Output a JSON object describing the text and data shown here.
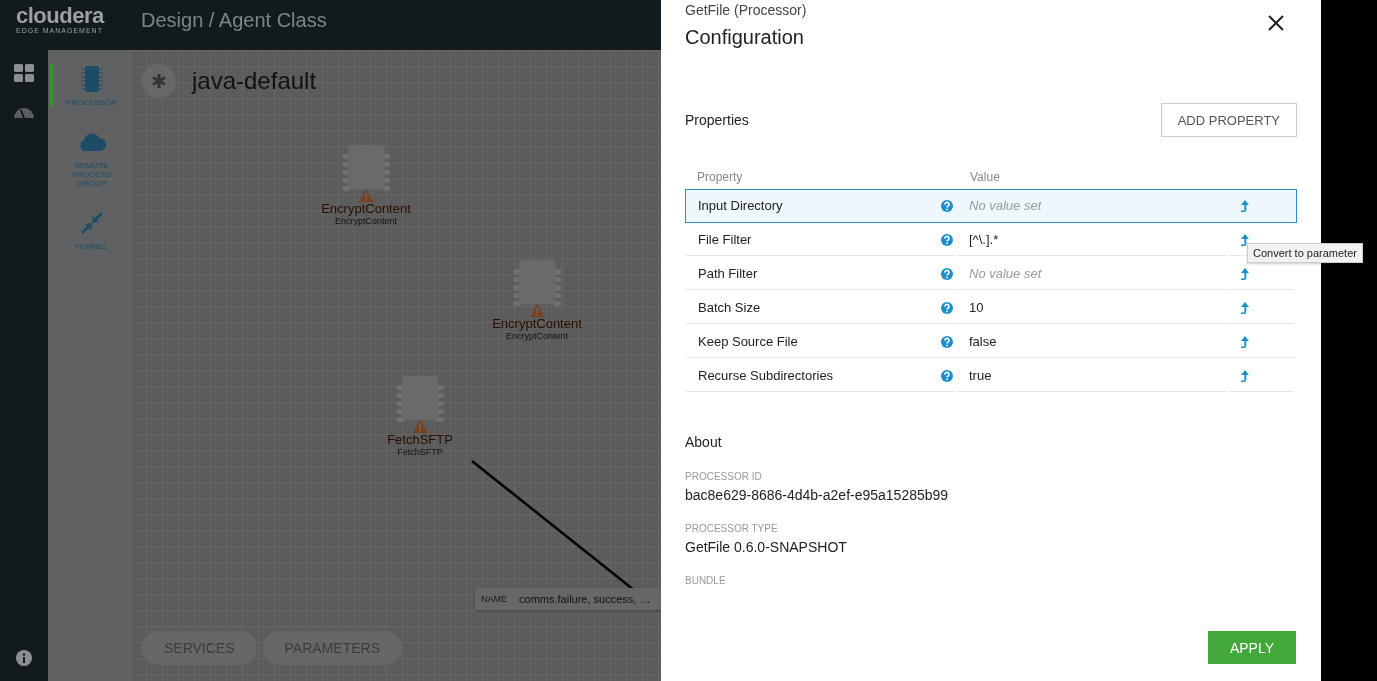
{
  "header": {
    "logo": "cloudera",
    "logo_subtitle": "EDGE MANAGEMENT",
    "breadcrumb": "Design / Agent Class"
  },
  "rail": {
    "items": [
      {
        "kind": "dashboard",
        "selected": true
      },
      {
        "kind": "monitor",
        "selected": false
      }
    ]
  },
  "palette": {
    "items": [
      {
        "kind": "processor",
        "label": "PROCESSOR",
        "selected": true
      },
      {
        "kind": "remote_group",
        "label": "REMOTE PROCESS GROUP",
        "selected": false
      },
      {
        "kind": "funnel",
        "label": "FUNNEL",
        "selected": false
      }
    ]
  },
  "canvas": {
    "flow_title": "java-default",
    "nodes": [
      {
        "name": "EncryptContent",
        "type": "EncryptContent",
        "warning": true
      },
      {
        "name": "EncryptContent",
        "type": "EncryptContent",
        "warning": true
      },
      {
        "name": "FetchSFTP",
        "type": "FetchSFTP",
        "warning": true
      }
    ],
    "connection": {
      "label_key": "NAME",
      "label_value": "comms.failure, success, …"
    },
    "bottom_buttons": [
      "SERVICES",
      "PARAMETERS"
    ]
  },
  "panel": {
    "subtitle": "GetFile (Processor)",
    "title": "Configuration",
    "properties": {
      "heading": "Properties",
      "add_button": "ADD PROPERTY",
      "columns": [
        "Property",
        "Value"
      ],
      "rows": [
        {
          "name": "Input Directory",
          "placeholder": "No value set",
          "selected": true
        },
        {
          "name": "File Filter",
          "value": "[^\\.].*",
          "selected": false
        },
        {
          "name": "Path Filter",
          "placeholder": "No value set",
          "selected": false
        },
        {
          "name": "Batch Size",
          "value": "10",
          "selected": false
        },
        {
          "name": "Keep Source File",
          "value": "false",
          "selected": false
        },
        {
          "name": "Recurse Subdirectories",
          "value": "true",
          "selected": false
        }
      ],
      "tooltip": "Convert to parameter"
    },
    "about": {
      "heading": "About",
      "fields": [
        {
          "label": "PROCESSOR ID",
          "value": "bac8e629-8686-4d4b-a2ef-e95a15285b99"
        },
        {
          "label": "PROCESSOR TYPE",
          "value": "GetFile 0.6.0-SNAPSHOT"
        },
        {
          "label": "BUNDLE"
        }
      ]
    },
    "apply_button": "APPLY"
  }
}
